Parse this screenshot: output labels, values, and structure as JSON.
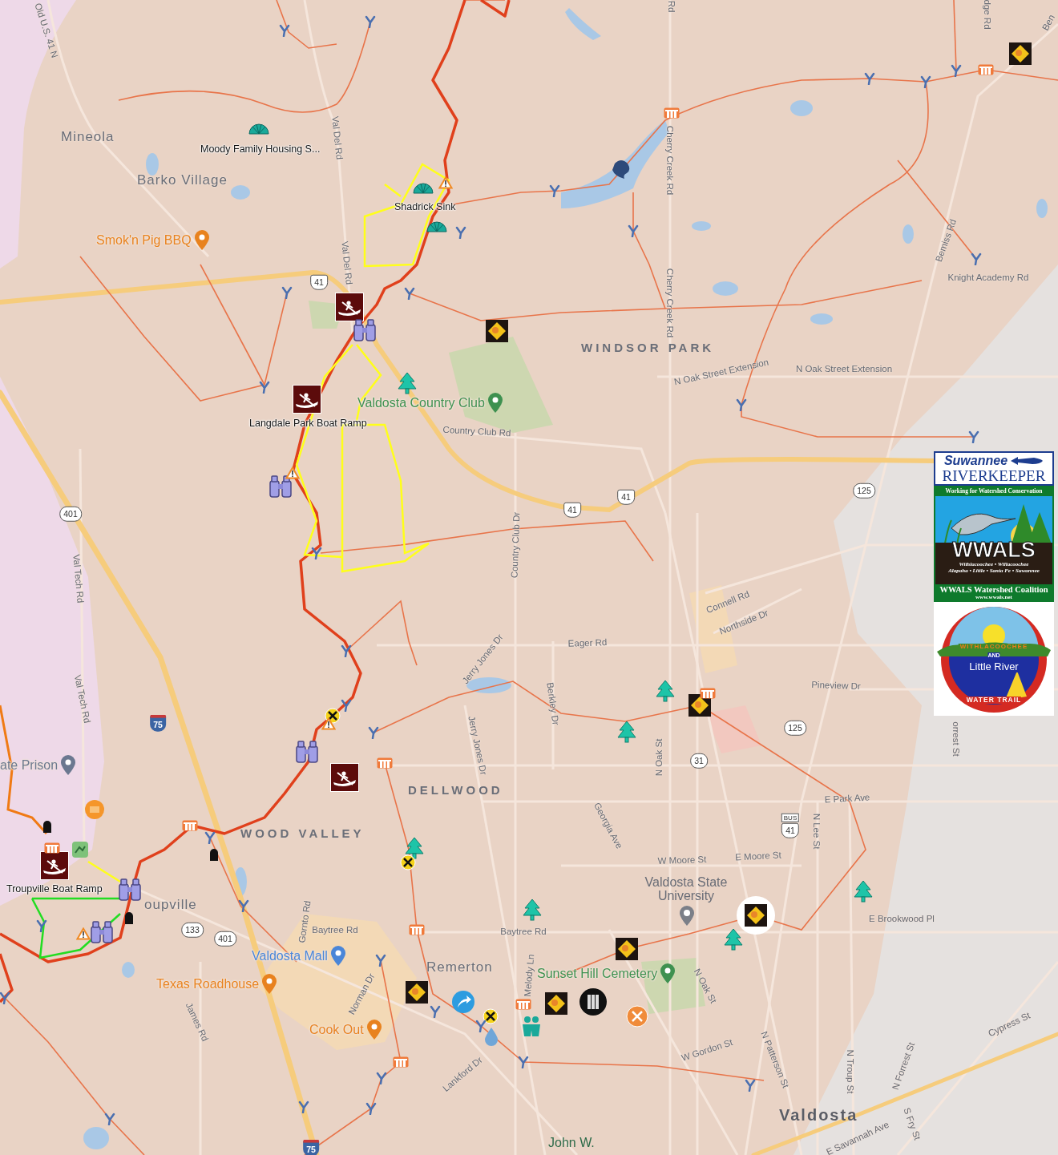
{
  "labels": [
    {
      "text": "Mineola",
      "kind": "place"
    },
    {
      "text": "Barko Village",
      "kind": "place"
    },
    {
      "text": "Moody Family Housing S...",
      "kind": "marker"
    },
    {
      "text": "Shadrick Sink",
      "kind": "marker"
    },
    {
      "text": "Smok'n Pig BBQ",
      "kind": "poi",
      "color": "#e8821e"
    },
    {
      "text": "WINDSOR PARK",
      "kind": "district"
    },
    {
      "text": "Valdosta Country Club",
      "kind": "poi",
      "color": "#3e9150"
    },
    {
      "text": "Langdale Park Boat Ramp",
      "kind": "marker"
    },
    {
      "text": "DELLWOOD",
      "kind": "district"
    },
    {
      "text": "ate Prison",
      "kind": "poi",
      "color": "#6b7890"
    },
    {
      "text": "WOOD VALLEY",
      "kind": "district"
    },
    {
      "text": "Troupville Boat Ramp",
      "kind": "marker"
    },
    {
      "text": "oupville",
      "kind": "place"
    },
    {
      "text": "Valdosta Mall",
      "kind": "poi",
      "color": "#4a86d8"
    },
    {
      "text": "Texas Roadhouse",
      "kind": "poi",
      "color": "#e8821e"
    },
    {
      "text": "Cook Out",
      "kind": "poi",
      "color": "#e8821e"
    },
    {
      "text": "Remerton",
      "kind": "place"
    },
    {
      "text": "Sunset Hill Cemetery",
      "kind": "poi",
      "color": "#3e9150"
    },
    {
      "text": "Valdosta State University",
      "kind": "campus"
    },
    {
      "text": "Valdosta",
      "kind": "city"
    },
    {
      "text": "John W.",
      "kind": "park"
    }
  ],
  "road_labels": [
    "Old U.S. 41 N",
    "Val Del Rd",
    "Val Del Rd",
    "Rd",
    "Cherry Creek Rd",
    "Cherry Creek Rd",
    "dge Rd",
    "Ben",
    "Bemiss Rd",
    "Knight Academy Rd",
    "N Oak Street Extension",
    "N Oak Street Extension",
    "Country Club Rd",
    "Country Club Dr",
    "Jerry Jones Dr",
    "Jerry Jones Dr",
    "Eager Rd",
    "Berkley Dr",
    "Connell Rd",
    "Northside Dr",
    "Pineview Dr",
    "N Oak St",
    "Georgia Ave",
    "E Park Ave",
    "N Lee St",
    "orrest St",
    "W Moore St",
    "E Moore St",
    "E Brookwood Pl",
    "Val Tech Rd",
    "Val Tech Rd",
    "Gornto Rd",
    "Baytree Rd",
    "Baytree Rd",
    "Norman Dr",
    "James Rd",
    "Lankford Dr",
    "Melody Ln",
    "N Oak St",
    "W Gordon St",
    "N Patterson St",
    "N Troup St",
    "N Forrest St",
    "S Fry St",
    "E Savannah Ave",
    "Cypress St"
  ],
  "shields": [
    {
      "text": "41",
      "kind": "us"
    },
    {
      "text": "41",
      "kind": "us"
    },
    {
      "text": "41",
      "kind": "us"
    },
    {
      "text": "401",
      "kind": "state"
    },
    {
      "text": "75",
      "kind": "interstate"
    },
    {
      "text": "125",
      "kind": "state"
    },
    {
      "text": "125",
      "kind": "state"
    },
    {
      "text": "31",
      "kind": "state"
    },
    {
      "text": "41",
      "kind": "business",
      "banner": "BUS"
    },
    {
      "text": "133",
      "kind": "state"
    },
    {
      "text": "401",
      "kind": "state"
    },
    {
      "text": "75",
      "kind": "interstate"
    }
  ],
  "logos": {
    "riverkeeper": {
      "name": "Suwannee",
      "title": "RIVERKEEPER",
      "tagline": "Working for Watershed Conservation"
    },
    "wwals": {
      "title": "WWALS",
      "rivers": [
        "Withlacoochee • Willacoochee",
        "Alapaha • Little • Santa Fe • Suwannee"
      ],
      "caption": "WWALS Watershed Coalition",
      "url": "www.wwals.net"
    },
    "water_trail": {
      "top": "WITHLACOOCHEE",
      "joiner": "AND",
      "middle": "Little River",
      "bottom": "WATER TRAIL"
    }
  }
}
